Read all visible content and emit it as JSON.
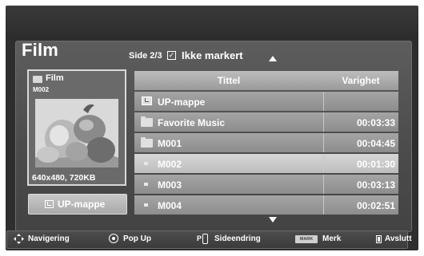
{
  "menu": {
    "title": "Film",
    "page_indicator": "Side 2/3",
    "unmarked_label": "Ikke markert",
    "checkbox_glyph": "☑"
  },
  "preview": {
    "folder_name": "Film",
    "item_code": "M002",
    "thumbnail": "fruit-photo",
    "info": "640x480, 720KB"
  },
  "up_button": {
    "label": "UP-mappe"
  },
  "table": {
    "columns": {
      "title": "Tittel",
      "duration": "Varighet"
    },
    "rows": [
      {
        "icon": "up-folder-icon",
        "name": "UP-mappe",
        "duration": "",
        "highlighted": false
      },
      {
        "icon": "folder-icon",
        "name": "Favorite Music",
        "duration": "00:03:33",
        "highlighted": false
      },
      {
        "icon": "folder-icon",
        "name": "M001",
        "duration": "00:04:45",
        "highlighted": false
      },
      {
        "icon": "file-icon",
        "name": "M002",
        "duration": "00:01:30",
        "highlighted": true
      },
      {
        "icon": "file-icon",
        "name": "M003",
        "duration": "00:03:13",
        "highlighted": false
      },
      {
        "icon": "file-icon",
        "name": "M004",
        "duration": "00:02:51",
        "highlighted": false
      }
    ]
  },
  "bottom_bar": {
    "navigation": "Navigering",
    "popup": "Pop Up",
    "page_change": "Sideendring",
    "page_key_glyph": "P",
    "mark_key": "MARK",
    "mark": "Merk",
    "exit": "Avslutt"
  },
  "colors": {
    "panel": "#4f4f4f",
    "row": "#9a9a9a",
    "highlight": "#c8c8c8",
    "text": "#ffffff"
  }
}
